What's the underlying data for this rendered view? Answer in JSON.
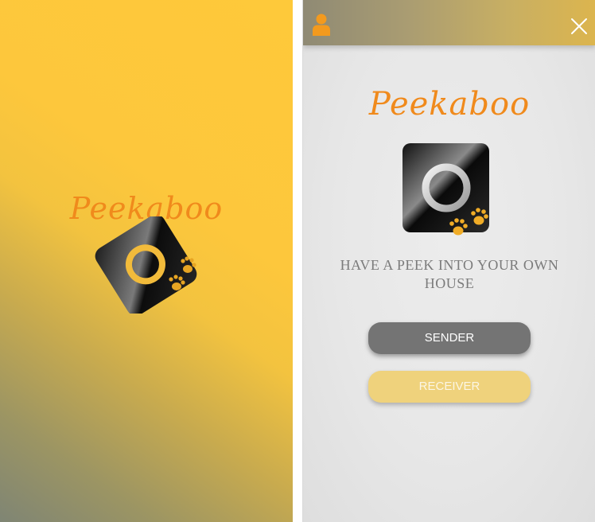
{
  "splash": {
    "title": "Peekaboo",
    "logo_icon": "camera-paw-logo-icon"
  },
  "app": {
    "header": {
      "profile_icon": "user-icon",
      "close_icon": "close-icon"
    },
    "title": "Peekaboo",
    "logo_icon": "camera-paw-logo-icon",
    "tagline": "HAVE A PEEK INTO YOUR OWN HOUSE",
    "buttons": {
      "sender_label": "SENDER",
      "receiver_label": "RECEIVER"
    }
  },
  "colors": {
    "brand_orange": "#f08a1c",
    "splash_yellow": "#fec93a",
    "sender_button": "#747474",
    "receiver_button": "#efd27c"
  }
}
